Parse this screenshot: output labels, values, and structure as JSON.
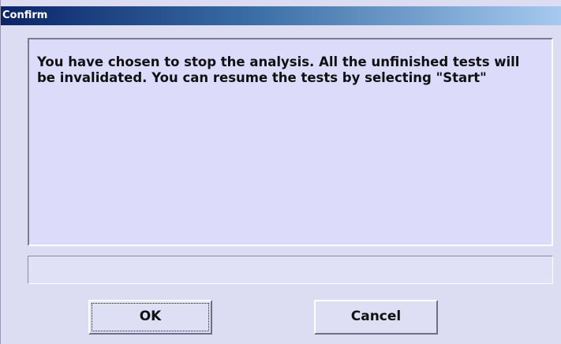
{
  "window": {
    "title": "Confirm"
  },
  "message": {
    "text": "You have chosen to stop the analysis. All the unfinished tests will be invalidated. You can resume the tests by selecting \"Start\""
  },
  "status": {
    "text": ""
  },
  "buttons": {
    "ok_label": "OK",
    "cancel_label": "Cancel"
  },
  "colors": {
    "dialog_background": "#dcdcf2",
    "titlebar_start": "#0a246a",
    "titlebar_end": "#a6caf0",
    "title_text": "#ffffff"
  }
}
